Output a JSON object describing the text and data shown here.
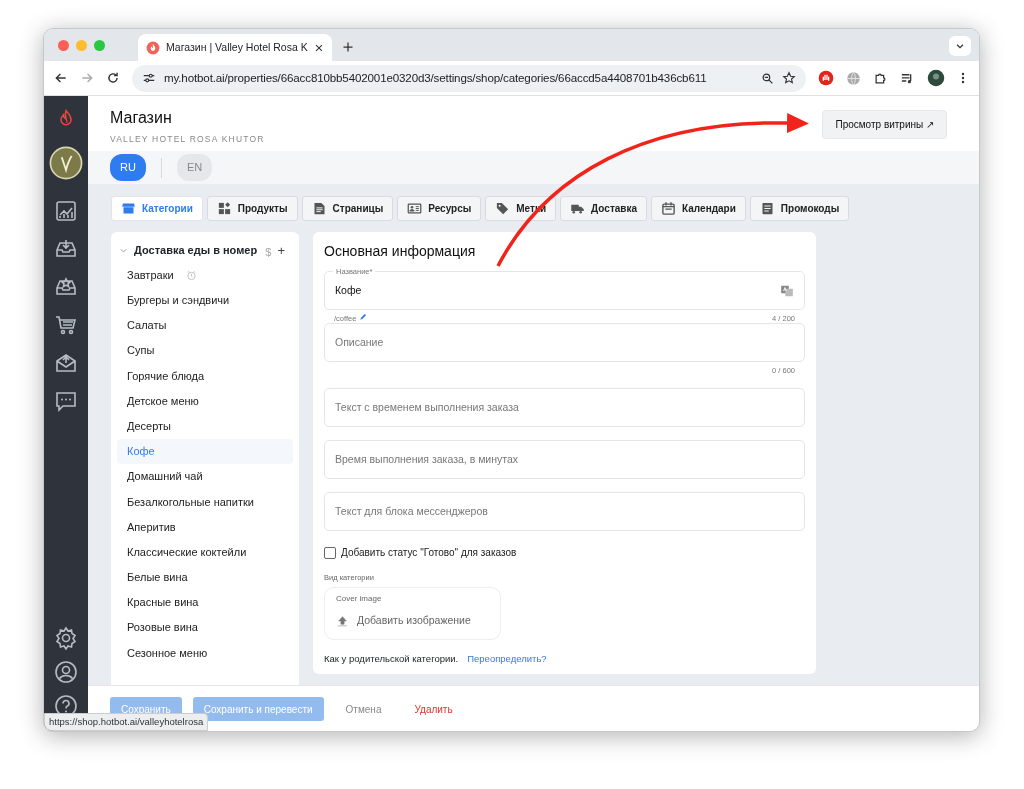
{
  "browser": {
    "tab_title": "Магазин | Valley Hotel Rosa K",
    "url": "my.hotbot.ai/properties/66acc810bb5402001e0320d3/settings/shop/categories/66accd5a4408701b436cb611",
    "status_url": "https://shop.hotbot.ai/valleyhotelrosa"
  },
  "header": {
    "title": "Магазин",
    "subtitle": "VALLEY HOTEL ROSA KHUTOR",
    "preview_button": "Просмотр витрины",
    "preview_icon": "↗"
  },
  "languages": [
    {
      "label": "RU",
      "selected": true
    },
    {
      "label": "EN",
      "selected": false
    }
  ],
  "tabs": [
    {
      "kind": "store",
      "label": "Категории",
      "selected": true
    },
    {
      "kind": "widgets",
      "label": "Продукты",
      "selected": false
    },
    {
      "kind": "page",
      "label": "Страницы",
      "selected": false
    },
    {
      "kind": "resource",
      "label": "Ресурсы",
      "selected": false
    },
    {
      "kind": "tag",
      "label": "Метки",
      "selected": false
    },
    {
      "kind": "truck",
      "label": "Доставка",
      "selected": false
    },
    {
      "kind": "calendar",
      "label": "Календари",
      "selected": false
    },
    {
      "kind": "promo",
      "label": "Промокоды",
      "selected": false
    }
  ],
  "category_tree": {
    "label": "Доставка еды в номер",
    "expanded": true,
    "price_icon": "$",
    "add_icon": "+",
    "children": [
      {
        "label": "Завтраки",
        "scheduled": true,
        "selected": false
      },
      {
        "label": "Бургеры и сэндвичи",
        "scheduled": false,
        "selected": false
      },
      {
        "label": "Салаты",
        "scheduled": false,
        "selected": false
      },
      {
        "label": "Супы",
        "scheduled": false,
        "selected": false
      },
      {
        "label": "Горячие блюда",
        "scheduled": false,
        "selected": false
      },
      {
        "label": "Детское меню",
        "scheduled": false,
        "selected": false
      },
      {
        "label": "Десерты",
        "scheduled": false,
        "selected": false
      },
      {
        "label": "Кофе",
        "scheduled": false,
        "selected": true
      },
      {
        "label": "Домашний чай",
        "scheduled": false,
        "selected": false
      },
      {
        "label": "Безалкогольные напитки",
        "scheduled": false,
        "selected": false
      },
      {
        "label": "Аперитив",
        "scheduled": false,
        "selected": false
      },
      {
        "label": "Классические коктейли",
        "scheduled": false,
        "selected": false
      },
      {
        "label": "Белые вина",
        "scheduled": false,
        "selected": false
      },
      {
        "label": "Красные вина",
        "scheduled": false,
        "selected": false
      },
      {
        "label": "Розовые вина",
        "scheduled": false,
        "selected": false
      },
      {
        "label": "Сезонное меню",
        "scheduled": false,
        "selected": false
      }
    ]
  },
  "form": {
    "title": "Основная информация",
    "fields": [
      {
        "label": "Название*",
        "value": "Кофе",
        "translate": true,
        "slug": "/coffee",
        "counter": "4 / 200"
      },
      {
        "placeholder": "Описание",
        "translate": false,
        "counter": "0 / 600"
      },
      {
        "placeholder": "Текст с временем выполнения заказа",
        "translate": false
      },
      {
        "placeholder": "Время выполнения заказа, в минутах",
        "translate": false
      },
      {
        "placeholder": "Текст для блока мессенджеров",
        "translate": false
      }
    ],
    "checkbox": {
      "label": "Добавить статус \"Готово\" для заказов",
      "checked": false
    },
    "view_label": "Вид категории",
    "cover": {
      "label": "Cover image",
      "action": "Добавить изображение"
    },
    "inherit_text": "Как у родительской категории.",
    "override_link": "Переопределить?"
  },
  "actions": [
    {
      "kind": "primary",
      "label": "Сохранить",
      "disabled": true
    },
    {
      "kind": "primary",
      "label": "Сохранить и перевести",
      "disabled": true
    },
    {
      "kind": "muted",
      "label": "Отмена"
    },
    {
      "kind": "danger",
      "label": "Удалить"
    }
  ]
}
